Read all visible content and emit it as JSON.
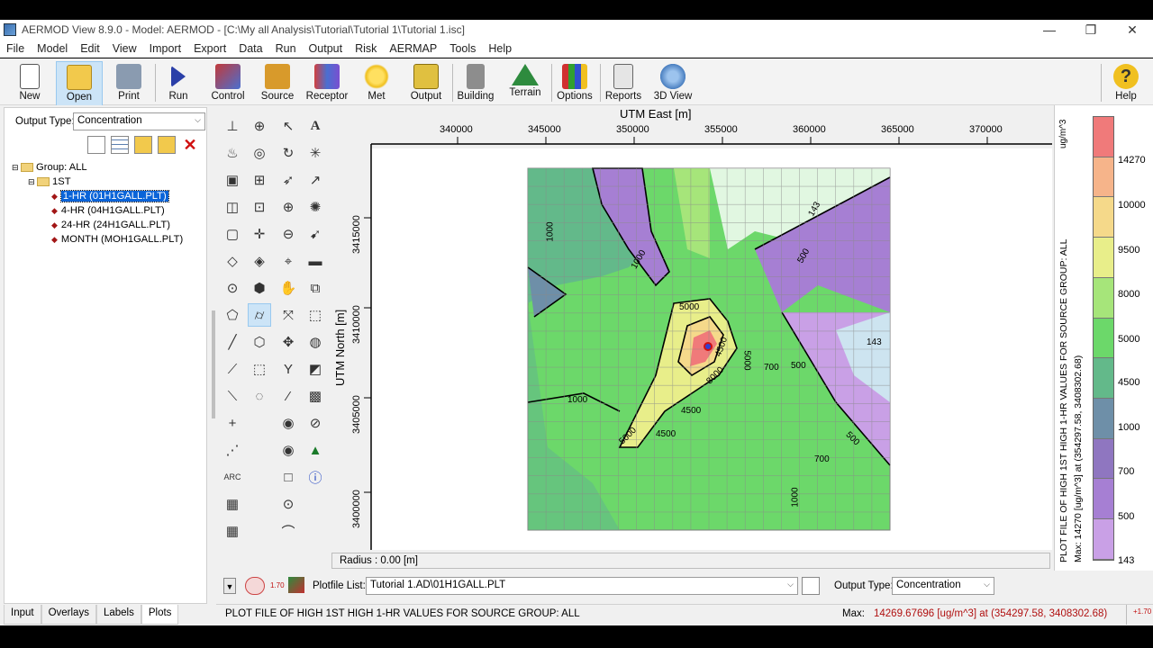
{
  "window": {
    "title": "AERMOD View 8.9.0 - Model: AERMOD  - [C:\\My all Analysis\\Tutorial\\Tutorial 1\\Tutorial 1.isc]"
  },
  "menu": [
    "File",
    "Model",
    "Edit",
    "View",
    "Import",
    "Export",
    "Data",
    "Run",
    "Output",
    "Risk",
    "AERMAP",
    "Tools",
    "Help"
  ],
  "toolbar": [
    {
      "label": "New",
      "icon": "new-file-icon",
      "color": "#ffffff"
    },
    {
      "label": "Open",
      "icon": "open-folder-icon",
      "color": "#f2c94c"
    },
    {
      "label": "Print",
      "icon": "printer-icon",
      "color": "#8a9bb0"
    },
    {
      "label": "Run",
      "icon": "run-arrow-icon",
      "color": "#2a3fa8"
    },
    {
      "label": "Control",
      "icon": "control-icon",
      "color": "#c23a3a"
    },
    {
      "label": "Source",
      "icon": "source-factory-icon",
      "color": "#d89a2b"
    },
    {
      "label": "Receptor",
      "icon": "receptor-icon",
      "color": "#7a4fd0"
    },
    {
      "label": "Met",
      "icon": "met-sun-icon",
      "color": "#f0c020"
    },
    {
      "label": "Output",
      "icon": "output-icon",
      "color": "#e0c040"
    },
    {
      "label": "Building",
      "icon": "building-icon",
      "color": "#8d8d8d"
    },
    {
      "label": "Terrain",
      "icon": "terrain-icon",
      "color": "#2e8b3e"
    },
    {
      "label": "Options",
      "icon": "options-grid-icon",
      "color": "#d03030"
    },
    {
      "label": "Reports",
      "icon": "reports-icon",
      "color": "#bcbcbc"
    },
    {
      "label": "3D View",
      "icon": "3d-view-icon",
      "color": "#4a7fc0"
    },
    {
      "label": "Help",
      "icon": "help-icon",
      "color": "#f0c020"
    }
  ],
  "leftpane": {
    "output_type_label": "Output Type:",
    "output_type_value": "Concentration",
    "tree": {
      "group": "Group: ALL",
      "sub": "1ST",
      "items": [
        "1-HR (01H1GALL.PLT)",
        "4-HR (04H1GALL.PLT)",
        "24-HR (24H1GALL.PLT)",
        "MONTH (MOH1GALL.PLT)"
      ]
    },
    "tabs": [
      "Input",
      "Overlays",
      "Labels",
      "Plots"
    ]
  },
  "plot": {
    "x_axis_title": "UTM East [m]",
    "x_ticks": [
      "340000",
      "345000",
      "350000",
      "355000",
      "360000",
      "365000",
      "370000"
    ],
    "y_axis_title": "UTM North [m]",
    "y_ticks": [
      "3415000",
      "3410000",
      "3405000",
      "3400000"
    ],
    "contour_labels": [
      "1000",
      "5000",
      "5000",
      "4500",
      "8000",
      "4500",
      "143",
      "500",
      "700",
      "143",
      "500",
      "1000",
      "5000",
      "1000",
      "700",
      "1000",
      "1000",
      "4500",
      "5000",
      "500"
    ],
    "radius": "Radius : 0.00 [m]"
  },
  "legend": {
    "unit": "ug/m^3",
    "title": "PLOT FILE OF HIGH 1ST HIGH 1-HR VALUES FOR SOURCE GROUP: ALL",
    "max_text": "Max:  14270  [ug/m^3]  at  (354297.58, 3408302.68)",
    "levels": [
      "14270",
      "10000",
      "9500",
      "8000",
      "5000",
      "4500",
      "1000",
      "700",
      "500",
      "143"
    ],
    "colors": [
      "#f07a7a",
      "#f6b48a",
      "#f5d98a",
      "#e8ee8a",
      "#a6e57a",
      "#6cd86a",
      "#63b98a",
      "#6e8fa8",
      "#8f76c0",
      "#a67fd3",
      "#c9a0e6"
    ]
  },
  "bottom": {
    "plotfile_label": "Plotfile List:",
    "plotfile_value": "Tutorial 1.AD\\01H1GALL.PLT",
    "output_type_label": "Output Type:",
    "output_type_value": "Concentration",
    "status": "PLOT FILE OF HIGH 1ST HIGH 1-HR VALUES FOR SOURCE GROUP: ALL",
    "max_label": "Max:",
    "max_value": "14269.67696  [ug/m^3]  at  (354297.58, 3408302.68)",
    "small_label": "1.70"
  }
}
